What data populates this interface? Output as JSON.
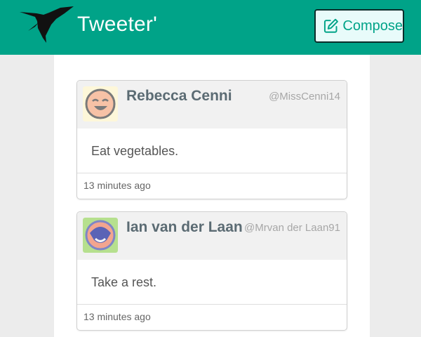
{
  "app": {
    "title": "Tweeter'",
    "logo_icon": "hummingbird-icon",
    "compose_label": "Compose",
    "compose_icon": "pencil-square-icon"
  },
  "colors": {
    "header_bg": "#00a388",
    "accent": "#00a388",
    "page_bg": "#ececec",
    "card_header_bg": "#f1f1f1"
  },
  "tweets": [
    {
      "name": "Rebecca Cenni",
      "handle": "@MissCenni14",
      "text": "Eat vegetables.",
      "time": "13 minutes ago",
      "avatar_icon": "laughing-face-icon"
    },
    {
      "name": "Ian van der Laan",
      "handle": "@Mrvan der Laan91",
      "text": "Take a rest.",
      "time": "13 minutes ago",
      "avatar_icon": "smiling-face-icon"
    }
  ]
}
